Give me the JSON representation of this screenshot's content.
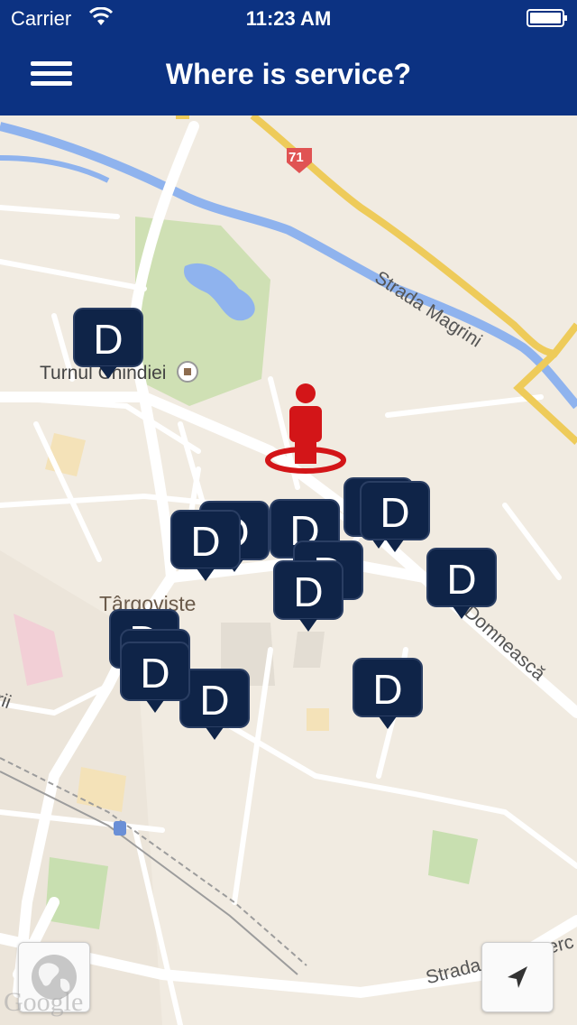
{
  "status": {
    "carrier": "Carrier",
    "time": "11:23 AM"
  },
  "nav": {
    "title": "Where is service?"
  },
  "map": {
    "labels": {
      "road71": "71",
      "strada_magrini": "Strada Magrini",
      "turnul": "Turnul Chindiei",
      "targoviste": "Târgoviște",
      "domneasca": "ca Domnească",
      "petru": "Strada Petru Cerc",
      "rii": "rii"
    },
    "google": "Google"
  },
  "marker_letter": "D",
  "colors": {
    "bar": "#0c3282",
    "marker": "#0f2448",
    "user": "#d31518"
  },
  "icons": {
    "menu": "hamburger-icon",
    "globe": "globe-icon",
    "location": "location-arrow-icon"
  }
}
